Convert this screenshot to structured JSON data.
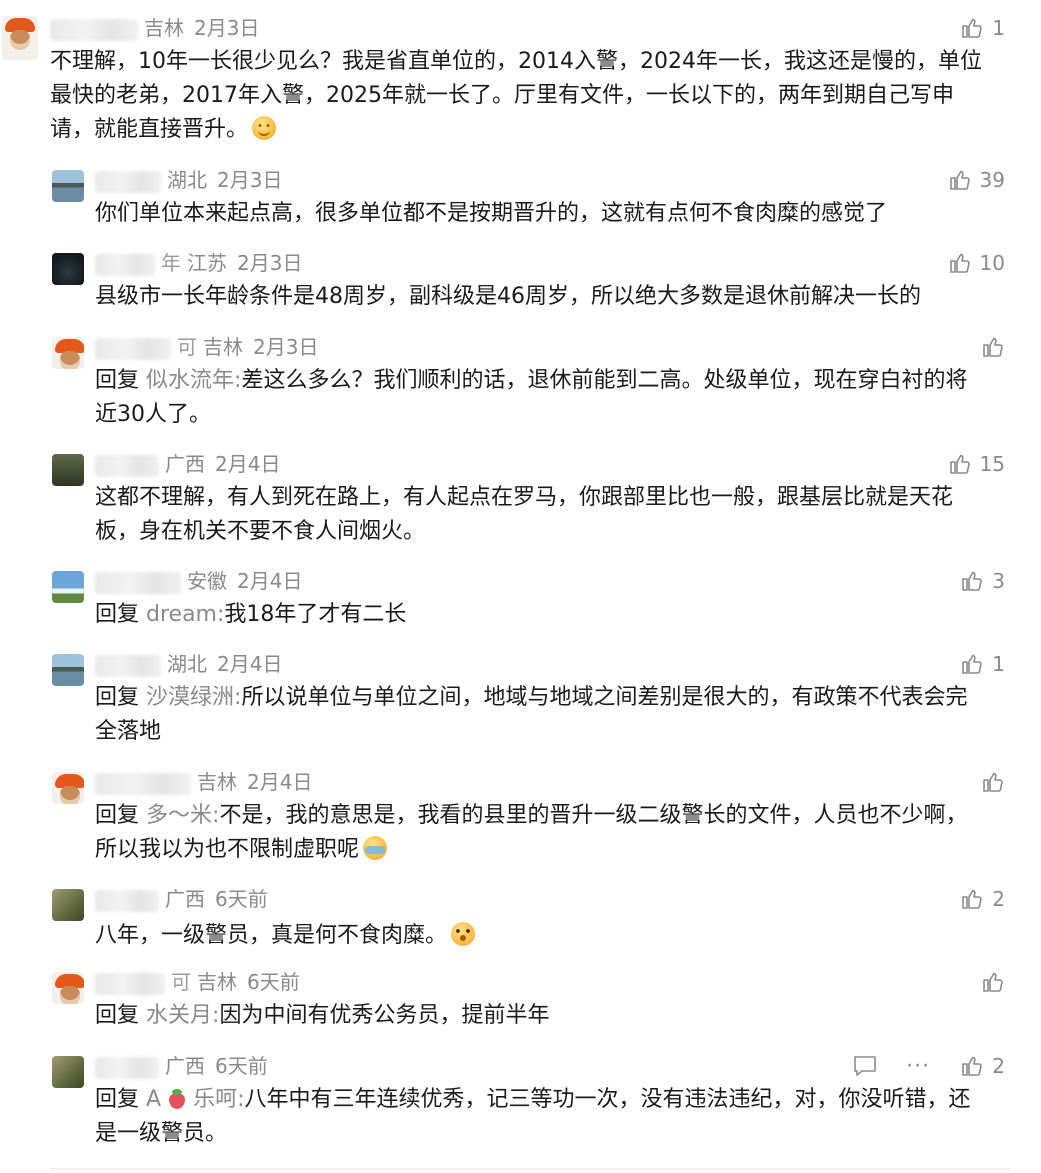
{
  "colors": {
    "text": "#1a1a1a",
    "meta": "#8a8a8a",
    "background": "#ffffff"
  },
  "comments": [
    {
      "avatar": "turban-avatar",
      "name_tail": "",
      "location": "吉林",
      "date": "2月3日",
      "likes": "1",
      "reply_to": "",
      "lines": [
        "不理解，10年一长很少见么？我是省直单位的，2014入警，2024年一长，我这还是慢的，单位",
        "最快的老弟，2017年入警，2025年就一长了。厅里有文件，一长以下的，两年到期自己写申",
        "请，就能直接晋升。"
      ]
    },
    {
      "avatar": "lake-avatar",
      "name_tail": "",
      "location": "湖北",
      "date": "2月3日",
      "likes": "39",
      "reply_to": "",
      "lines": [
        "你们单位本来起点高，很多单位都不是按期晋升的，这就有点何不食肉糜的感觉了"
      ]
    },
    {
      "avatar": "night-avatar",
      "name_tail": "年",
      "location": "江苏",
      "date": "2月3日",
      "likes": "10",
      "reply_to": "",
      "lines": [
        "县级市一长年龄条件是48周岁，副科级是46周岁，所以绝大多数是退休前解决一长的"
      ]
    },
    {
      "avatar": "turban-avatar",
      "name_tail": "可",
      "location": "吉林",
      "date": "2月3日",
      "likes": "",
      "reply_to": "似水流年:",
      "lines": [
        "差这么多么？我们顺利的话，退休前能到二高。处级单位，现在穿白衬的将",
        "近30人了。"
      ]
    },
    {
      "avatar": "forest-avatar",
      "name_tail": "",
      "location": "广西",
      "date": "2月4日",
      "likes": "15",
      "reply_to": "",
      "lines": [
        "这都不理解，有人到死在路上，有人起点在罗马，你跟部里比也一般，跟基层比就是天花",
        "板，身在机关不要不食人间烟火。"
      ]
    },
    {
      "avatar": "sky-avatar",
      "name_tail": "",
      "location": "安徽",
      "date": "2月4日",
      "likes": "3",
      "reply_to": "dream:",
      "lines": [
        "我18年了才有二长"
      ]
    },
    {
      "avatar": "lake-avatar",
      "name_tail": "",
      "location": "湖北",
      "date": "2月4日",
      "likes": "1",
      "reply_to": "沙漠绿洲:",
      "lines": [
        "所以说单位与单位之间，地域与地域之间差别是很大的，有政策不代表会完",
        "全落地"
      ]
    },
    {
      "avatar": "turban-avatar",
      "name_tail": "",
      "location": "吉林",
      "date": "2月4日",
      "likes": "",
      "reply_to": "多～米:",
      "lines": [
        "不是，我的意思是，我看的县里的晋升一级二级警长的文件，人员也不少啊，",
        "所以我以为也不限制虚职呢"
      ]
    },
    {
      "avatar": "tree-avatar",
      "name_tail": "",
      "location": "广西",
      "date": "6天前",
      "likes": "2",
      "reply_to": "",
      "lines": [
        "八年，一级警员，真是何不食肉糜。"
      ]
    },
    {
      "avatar": "turban-avatar",
      "name_tail": "可",
      "location": "吉林",
      "date": "6天前",
      "likes": "",
      "reply_to": "水关月:",
      "lines": [
        "因为中间有优秀公务员，提前半年"
      ]
    },
    {
      "avatar": "tree-avatar",
      "name_tail": "",
      "location": "广西",
      "date": "6天前",
      "likes": "2",
      "reply_to": "A",
      "reply_to_suffix": "乐呵:",
      "lines": [
        "八年中有三年连续优秀，记三等功一次，没有违法违纪，对，你没听错，还",
        "是一级警员。"
      ]
    }
  ],
  "labels": {
    "reply": "回复"
  },
  "icons": {
    "like": "thumbs-up-icon",
    "comment": "comment-icon",
    "more": "more-icon"
  },
  "more_glyph": "···"
}
